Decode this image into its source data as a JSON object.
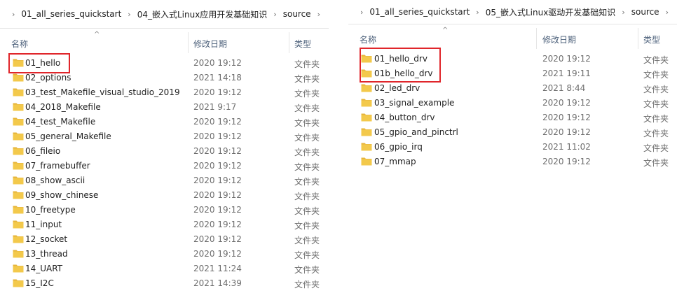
{
  "left": {
    "breadcrumb": [
      "01_all_series_quickstart",
      "04_嵌入式Linux应用开发基础知识",
      "source"
    ],
    "columns": {
      "name": "名称",
      "date": "修改日期",
      "type": "类型"
    },
    "sort_indicator": "^",
    "files": [
      {
        "name": "01_hello",
        "date": "2020 19:12",
        "type": "文件夹"
      },
      {
        "name": "02_options",
        "date": "2021 14:18",
        "type": "文件夹"
      },
      {
        "name": "03_test_Makefile_visual_studio_2019",
        "date": "2020 19:12",
        "type": "文件夹"
      },
      {
        "name": "04_2018_Makefile",
        "date": "2021 9:17",
        "type": "文件夹"
      },
      {
        "name": "04_test_Makefile",
        "date": "2020 19:12",
        "type": "文件夹"
      },
      {
        "name": "05_general_Makefile",
        "date": "2020 19:12",
        "type": "文件夹"
      },
      {
        "name": "06_fileio",
        "date": "2020 19:12",
        "type": "文件夹"
      },
      {
        "name": "07_framebuffer",
        "date": "2020 19:12",
        "type": "文件夹"
      },
      {
        "name": "08_show_ascii",
        "date": "2020 19:12",
        "type": "文件夹"
      },
      {
        "name": "09_show_chinese",
        "date": "2020 19:12",
        "type": "文件夹"
      },
      {
        "name": "10_freetype",
        "date": "2020 19:12",
        "type": "文件夹"
      },
      {
        "name": "11_input",
        "date": "2020 19:12",
        "type": "文件夹"
      },
      {
        "name": "12_socket",
        "date": "2020 19:12",
        "type": "文件夹"
      },
      {
        "name": "13_thread",
        "date": "2020 19:12",
        "type": "文件夹"
      },
      {
        "name": "14_UART",
        "date": "2021 11:24",
        "type": "文件夹"
      },
      {
        "name": "15_I2C",
        "date": "2021 14:39",
        "type": "文件夹"
      }
    ]
  },
  "right": {
    "breadcrumb": [
      "01_all_series_quickstart",
      "05_嵌入式Linux驱动开发基础知识",
      "source"
    ],
    "columns": {
      "name": "名称",
      "date": "修改日期",
      "type": "类型"
    },
    "sort_indicator": "^",
    "files": [
      {
        "name": "01_hello_drv",
        "date": "2020 19:12",
        "type": "文件夹"
      },
      {
        "name": "01b_hello_drv",
        "date": "2021 19:11",
        "type": "文件夹"
      },
      {
        "name": "02_led_drv",
        "date": "2021 8:44",
        "type": "文件夹"
      },
      {
        "name": "03_signal_example",
        "date": "2020 19:12",
        "type": "文件夹"
      },
      {
        "name": "04_button_drv",
        "date": "2020 19:12",
        "type": "文件夹"
      },
      {
        "name": "05_gpio_and_pinctrl",
        "date": "2020 19:12",
        "type": "文件夹"
      },
      {
        "name": "06_gpio_irq",
        "date": "2021 11:02",
        "type": "文件夹"
      },
      {
        "name": "07_mmap",
        "date": "2020 19:12",
        "type": "文件夹"
      }
    ]
  },
  "colors": {
    "highlight_border": "#e0262b",
    "folder": "#f3c94b",
    "header_text": "#4c607a"
  },
  "icons": {
    "folder": "folder-icon",
    "chevron": "chevron-right-icon"
  }
}
